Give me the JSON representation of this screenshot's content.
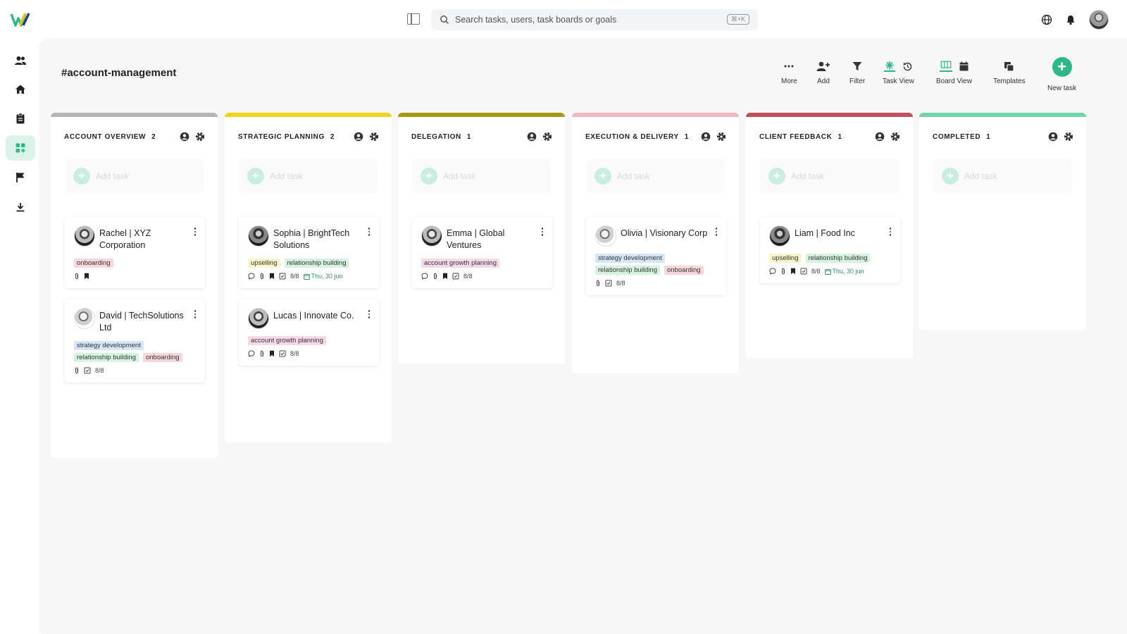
{
  "app": {
    "search_placeholder": "Search tasks, users, task boards or goals",
    "search_shortcut": "⌘+K",
    "accent_color": "#2bb98a"
  },
  "board": {
    "title": "#account-management"
  },
  "toolbar": {
    "more": "More",
    "add": "Add",
    "filter": "Filter",
    "task_view": "Task View",
    "board_view": "Board View",
    "templates": "Templates",
    "new_task": "New task"
  },
  "sidebar": {
    "items": [
      "users-icon",
      "home-icon",
      "clipboard-icon",
      "board-icon",
      "flag-icon",
      "download-icon"
    ],
    "active_index": 3
  },
  "add_task_label": "Add task",
  "tag_colors": {
    "onboarding": "#f7d6dc",
    "upselling": "#f8f6c8",
    "relationship building": "#d6f3df",
    "strategy development": "#d4e6f7",
    "account growth planning": "#f6d9e8"
  },
  "columns": [
    {
      "title": "ACCOUNT OVERVIEW",
      "count": "2",
      "color": "#b5b5b5",
      "cards": [
        {
          "name": "Rachel | XYZ Corporation",
          "avatar": "av-a",
          "tags": [
            "onboarding"
          ],
          "meta": {
            "attach": true,
            "bookmark": true
          }
        },
        {
          "name": "David | TechSolutions Ltd",
          "avatar": "av-b",
          "tags": [
            "strategy development",
            "relationship building",
            "onboarding"
          ],
          "meta": {
            "attach": true,
            "check": "8/8"
          }
        }
      ]
    },
    {
      "title": "STRATEGIC PLANNING",
      "count": "2",
      "color": "#f2d417",
      "cards": [
        {
          "name": "Sophia | BrightTech Solutions",
          "avatar": "av-c",
          "tags": [
            "upselling",
            "relationship building"
          ],
          "meta": {
            "comment": true,
            "attach": true,
            "bookmark": true,
            "check": "8/8",
            "date": "Thu, 30 jun"
          }
        },
        {
          "name": "Lucas | Innovate Co.",
          "avatar": "av-a",
          "tags": [
            "account growth planning"
          ],
          "meta": {
            "comment": true,
            "attach": true,
            "bookmark": true,
            "check": "8/8"
          }
        }
      ]
    },
    {
      "title": "DELEGATION",
      "count": "1",
      "color": "#a69a14",
      "cards": [
        {
          "name": "Emma | Global Ventures",
          "avatar": "av-a",
          "tags": [
            "account growth planning"
          ],
          "meta": {
            "comment": true,
            "attach": true,
            "bookmark": true,
            "check": "8/8"
          }
        }
      ]
    },
    {
      "title": "EXECUTION & DELIVERY",
      "count": "1",
      "color": "#f1b8c4",
      "cards": [
        {
          "name": "Olivia | Visionary Corp",
          "avatar": "av-b",
          "tags": [
            "strategy development",
            "relationship building",
            "onboarding"
          ],
          "meta": {
            "attach": true,
            "check": "8/8"
          }
        }
      ]
    },
    {
      "title": "CLIENT FEEDBACK",
      "count": "1",
      "color": "#c0505e",
      "cards": [
        {
          "name": "Liam | Food Inc",
          "avatar": "av-c",
          "tags": [
            "upselling",
            "relationship building"
          ],
          "meta": {
            "comment": true,
            "attach": true,
            "bookmark": true,
            "check": "8/8",
            "date": "Thu, 30 jun"
          }
        }
      ]
    },
    {
      "title": "COMPLETED",
      "count": "1",
      "color": "#6fd6a6",
      "cards": []
    }
  ]
}
